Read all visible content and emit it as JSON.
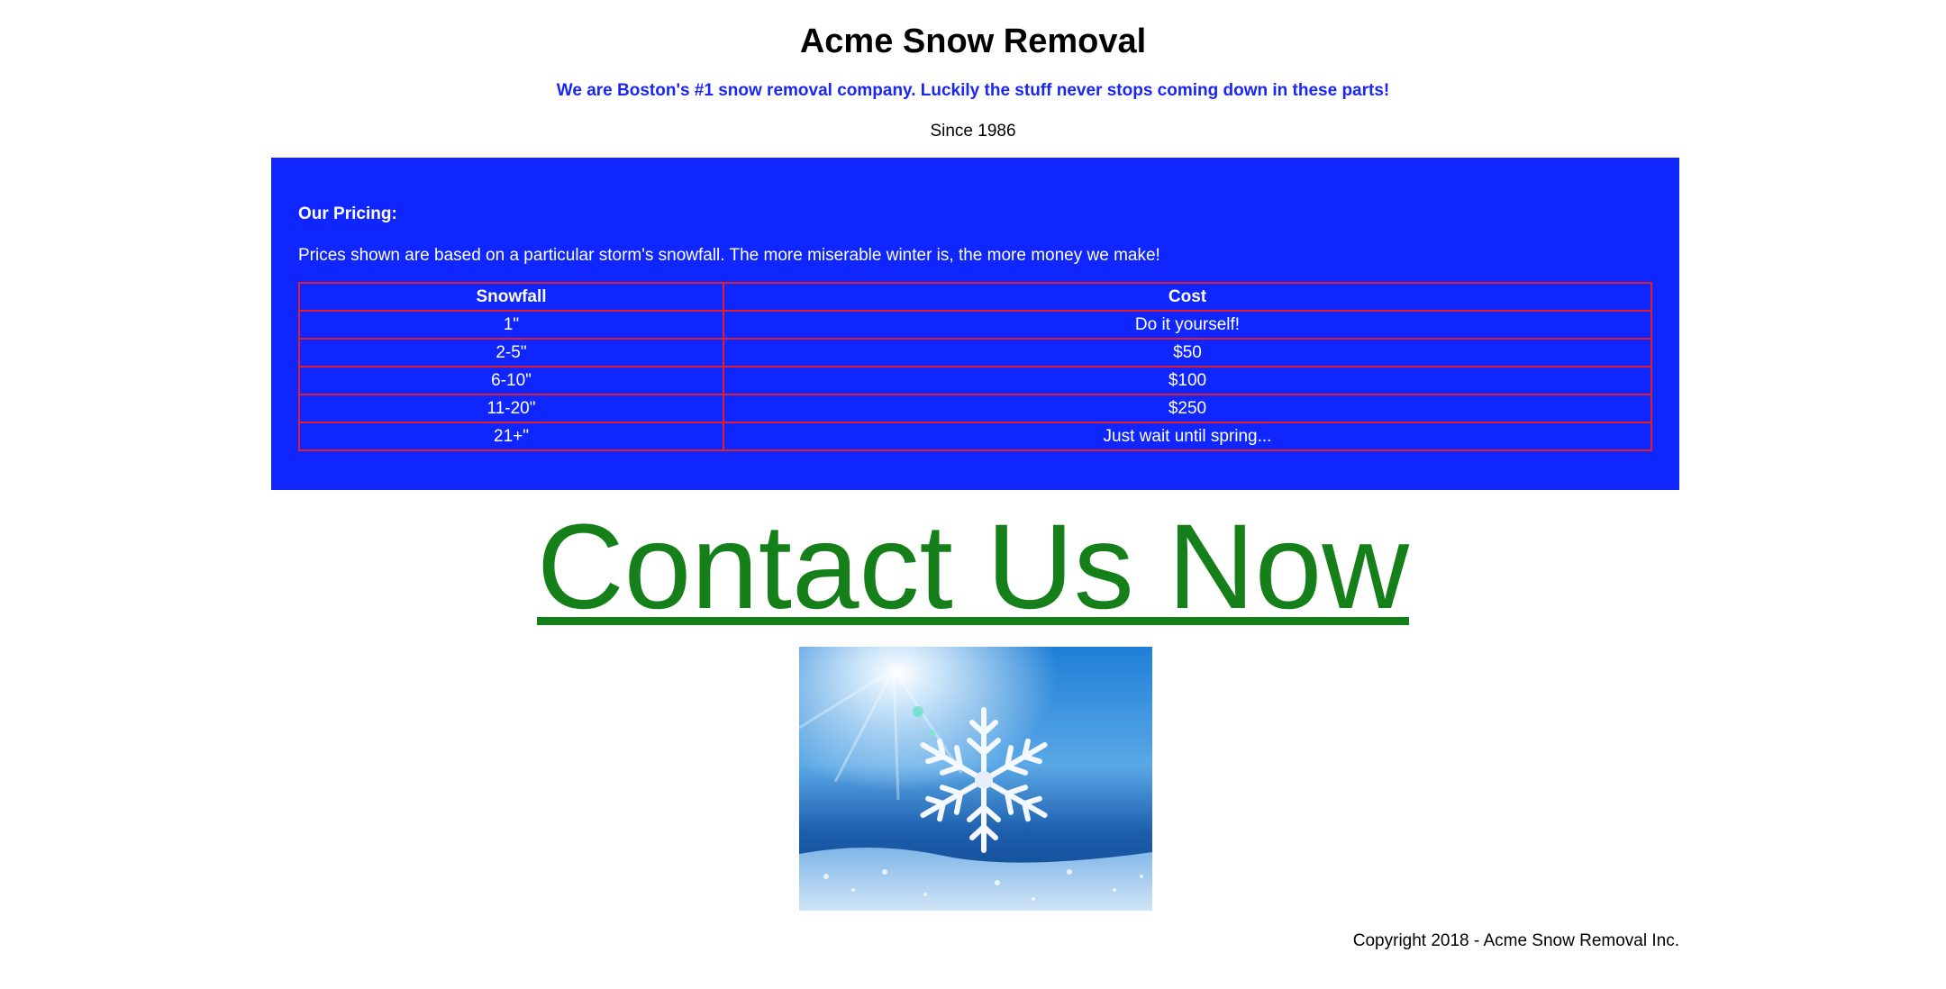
{
  "header": {
    "title": "Acme Snow Removal",
    "tagline": "We are Boston's #1 snow removal company. Luckily the stuff never stops coming down in these parts!",
    "since": "Since 1986"
  },
  "pricing": {
    "heading": "Our Pricing:",
    "description": "Prices shown are based on a particular storm's snowfall. The more miserable winter is, the more money we make!",
    "columns": [
      "Snowfall",
      "Cost"
    ],
    "rows": [
      [
        "1\"",
        "Do it yourself!"
      ],
      [
        "2-5\"",
        "$50"
      ],
      [
        "6-10\"",
        "$100"
      ],
      [
        "11-20\"",
        "$250"
      ],
      [
        "21+\"",
        "Just wait until spring..."
      ]
    ]
  },
  "contact": {
    "link_text": "Contact Us Now"
  },
  "image": {
    "icon": "snowflake-photo"
  },
  "footer": {
    "copyright": "Copyright 2018 - Acme Snow Removal Inc."
  },
  "colors": {
    "panel_blue": "#0f26ff",
    "tagline_blue": "#1a26f2",
    "table_border_red": "#e0202a",
    "link_green": "#15801a"
  }
}
